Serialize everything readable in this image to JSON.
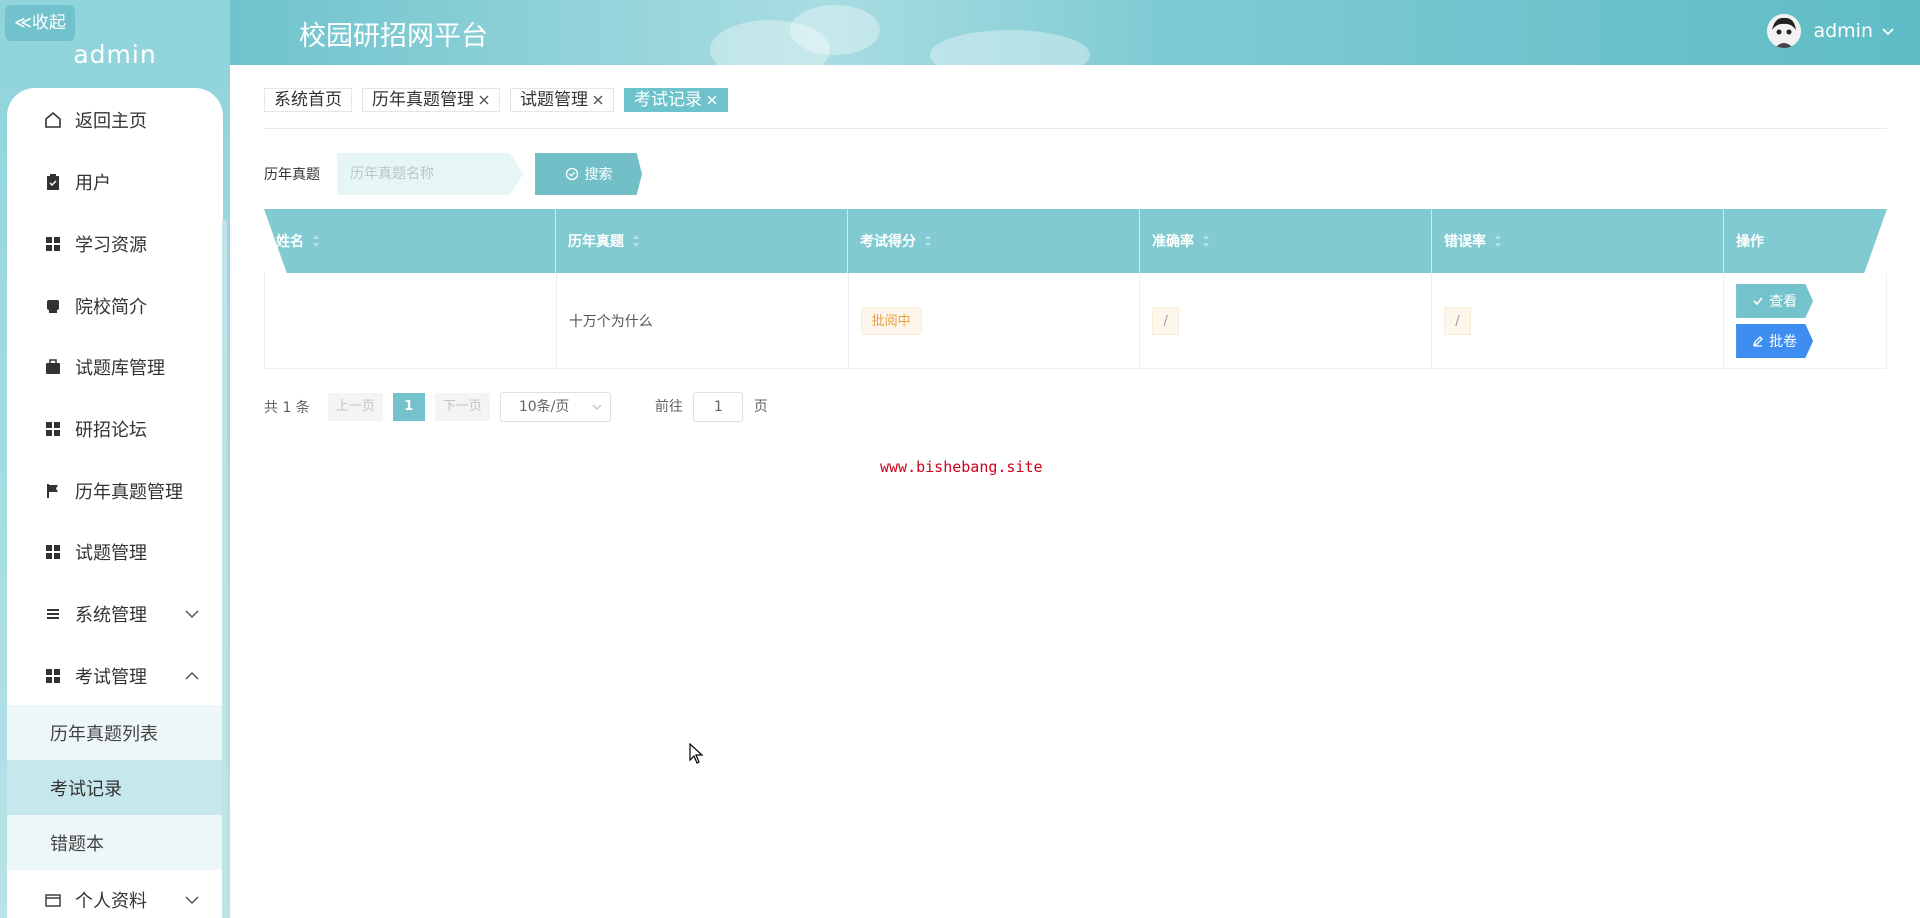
{
  "sidebar": {
    "collapse_label": "≪收起",
    "username": "admin",
    "items": [
      {
        "label": "返回主页",
        "icon": "home-icon"
      },
      {
        "label": "用户",
        "icon": "clipboard-icon"
      },
      {
        "label": "学习资源",
        "icon": "grid-icon"
      },
      {
        "label": "院校简介",
        "icon": "book-icon"
      },
      {
        "label": "试题库管理",
        "icon": "briefcase-icon"
      },
      {
        "label": "研招论坛",
        "icon": "grid-icon"
      },
      {
        "label": "历年真题管理",
        "icon": "flag-icon"
      },
      {
        "label": "试题管理",
        "icon": "grid-icon"
      },
      {
        "label": "系统管理",
        "icon": "list-icon"
      },
      {
        "label": "考试管理",
        "icon": "grid-icon"
      }
    ],
    "sub_items": [
      {
        "label": "历年真题列表"
      },
      {
        "label": "考试记录"
      },
      {
        "label": "错题本"
      }
    ],
    "bottom_item": {
      "label": "个人资料",
      "icon": "card-icon"
    }
  },
  "header": {
    "title": "校园研招网平台",
    "username": "admin"
  },
  "tabs": [
    {
      "label": "系统首页",
      "closable": false
    },
    {
      "label": "历年真题管理",
      "closable": true
    },
    {
      "label": "试题管理",
      "closable": true
    },
    {
      "label": "考试记录",
      "closable": true,
      "active": true
    }
  ],
  "search": {
    "label": "历年真题",
    "placeholder": "历年真题名称",
    "button_label": "搜索"
  },
  "table": {
    "columns": [
      "姓名",
      "历年真题",
      "考试得分",
      "准确率",
      "错误率",
      "操作"
    ],
    "rows": [
      {
        "name": "",
        "paper": "十万个为什么",
        "score": "批阅中",
        "accuracy": "/",
        "error_rate": "/"
      }
    ],
    "view_label": "查看",
    "grade_label": "批卷"
  },
  "pagination": {
    "total": "共 1 条",
    "prev": "上一页",
    "current": "1",
    "next": "下一页",
    "page_size": "10条/页",
    "goto_prefix": "前往",
    "goto_value": "1",
    "goto_suffix": "页"
  },
  "watermark": "www.bishebang.site",
  "colors": {
    "accent": "#72bfc8",
    "header_bg": "#6fc3cc",
    "grade_button": "#3d8ef0",
    "watermark": "#d0021b"
  }
}
